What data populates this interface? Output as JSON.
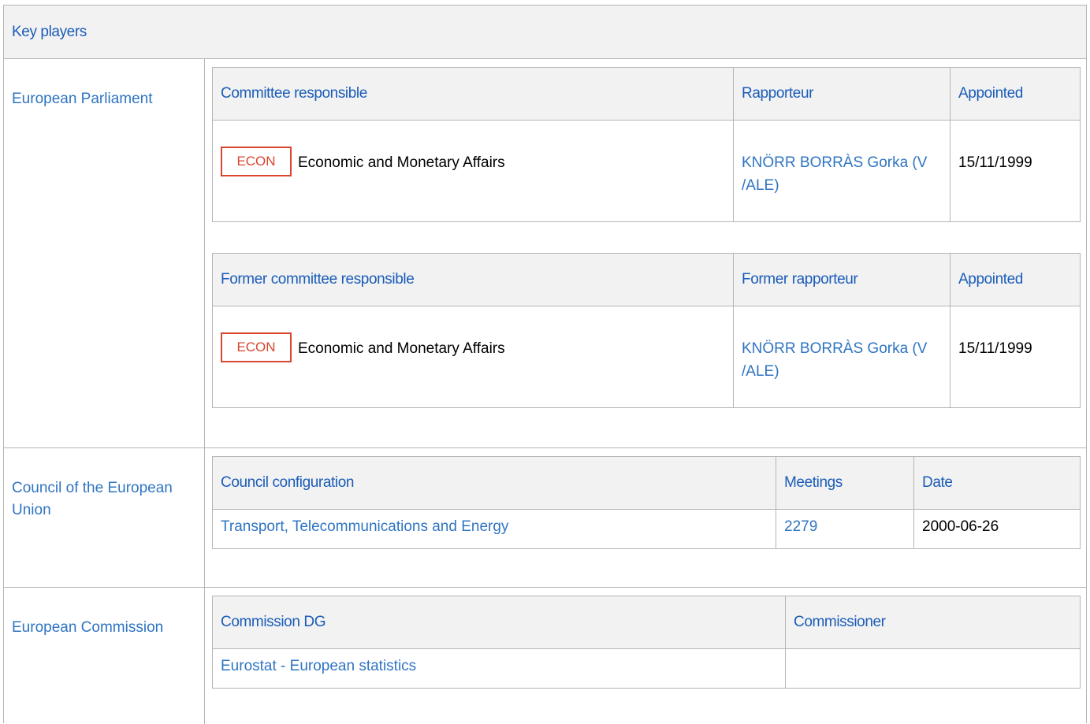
{
  "header": {
    "title": "Key players"
  },
  "parliament": {
    "label": "European Parliament",
    "current": {
      "col_committee": "Committee responsible",
      "col_rapporteur": "Rapporteur",
      "col_appointed": "Appointed",
      "badge": "ECON",
      "committee": "Economic and Monetary Affairs",
      "rapporteur_line1": "KNÖRR BORRÀS Gorka (V",
      "rapporteur_line2": "/ALE)",
      "appointed": "15/11/1999"
    },
    "former": {
      "col_committee": "Former committee responsible",
      "col_rapporteur": "Former rapporteur",
      "col_appointed": "Appointed",
      "badge": "ECON",
      "committee": "Economic and Monetary Affairs",
      "rapporteur_line1": "KNÖRR BORRÀS Gorka (V",
      "rapporteur_line2": "/ALE)",
      "appointed": "15/11/1999"
    }
  },
  "council": {
    "label_line1": "Council of the European",
    "label_line2": "Union",
    "col_config": "Council configuration",
    "col_meetings": "Meetings",
    "col_date": "Date",
    "config": "Transport, Telecommunications and Energy",
    "meetings": "2279",
    "date": "2000-06-26"
  },
  "commission": {
    "label": "European Commission",
    "col_dg": "Commission DG",
    "col_commissioner": "Commissioner",
    "dg": "Eurostat - European statistics",
    "commissioner": ""
  }
}
